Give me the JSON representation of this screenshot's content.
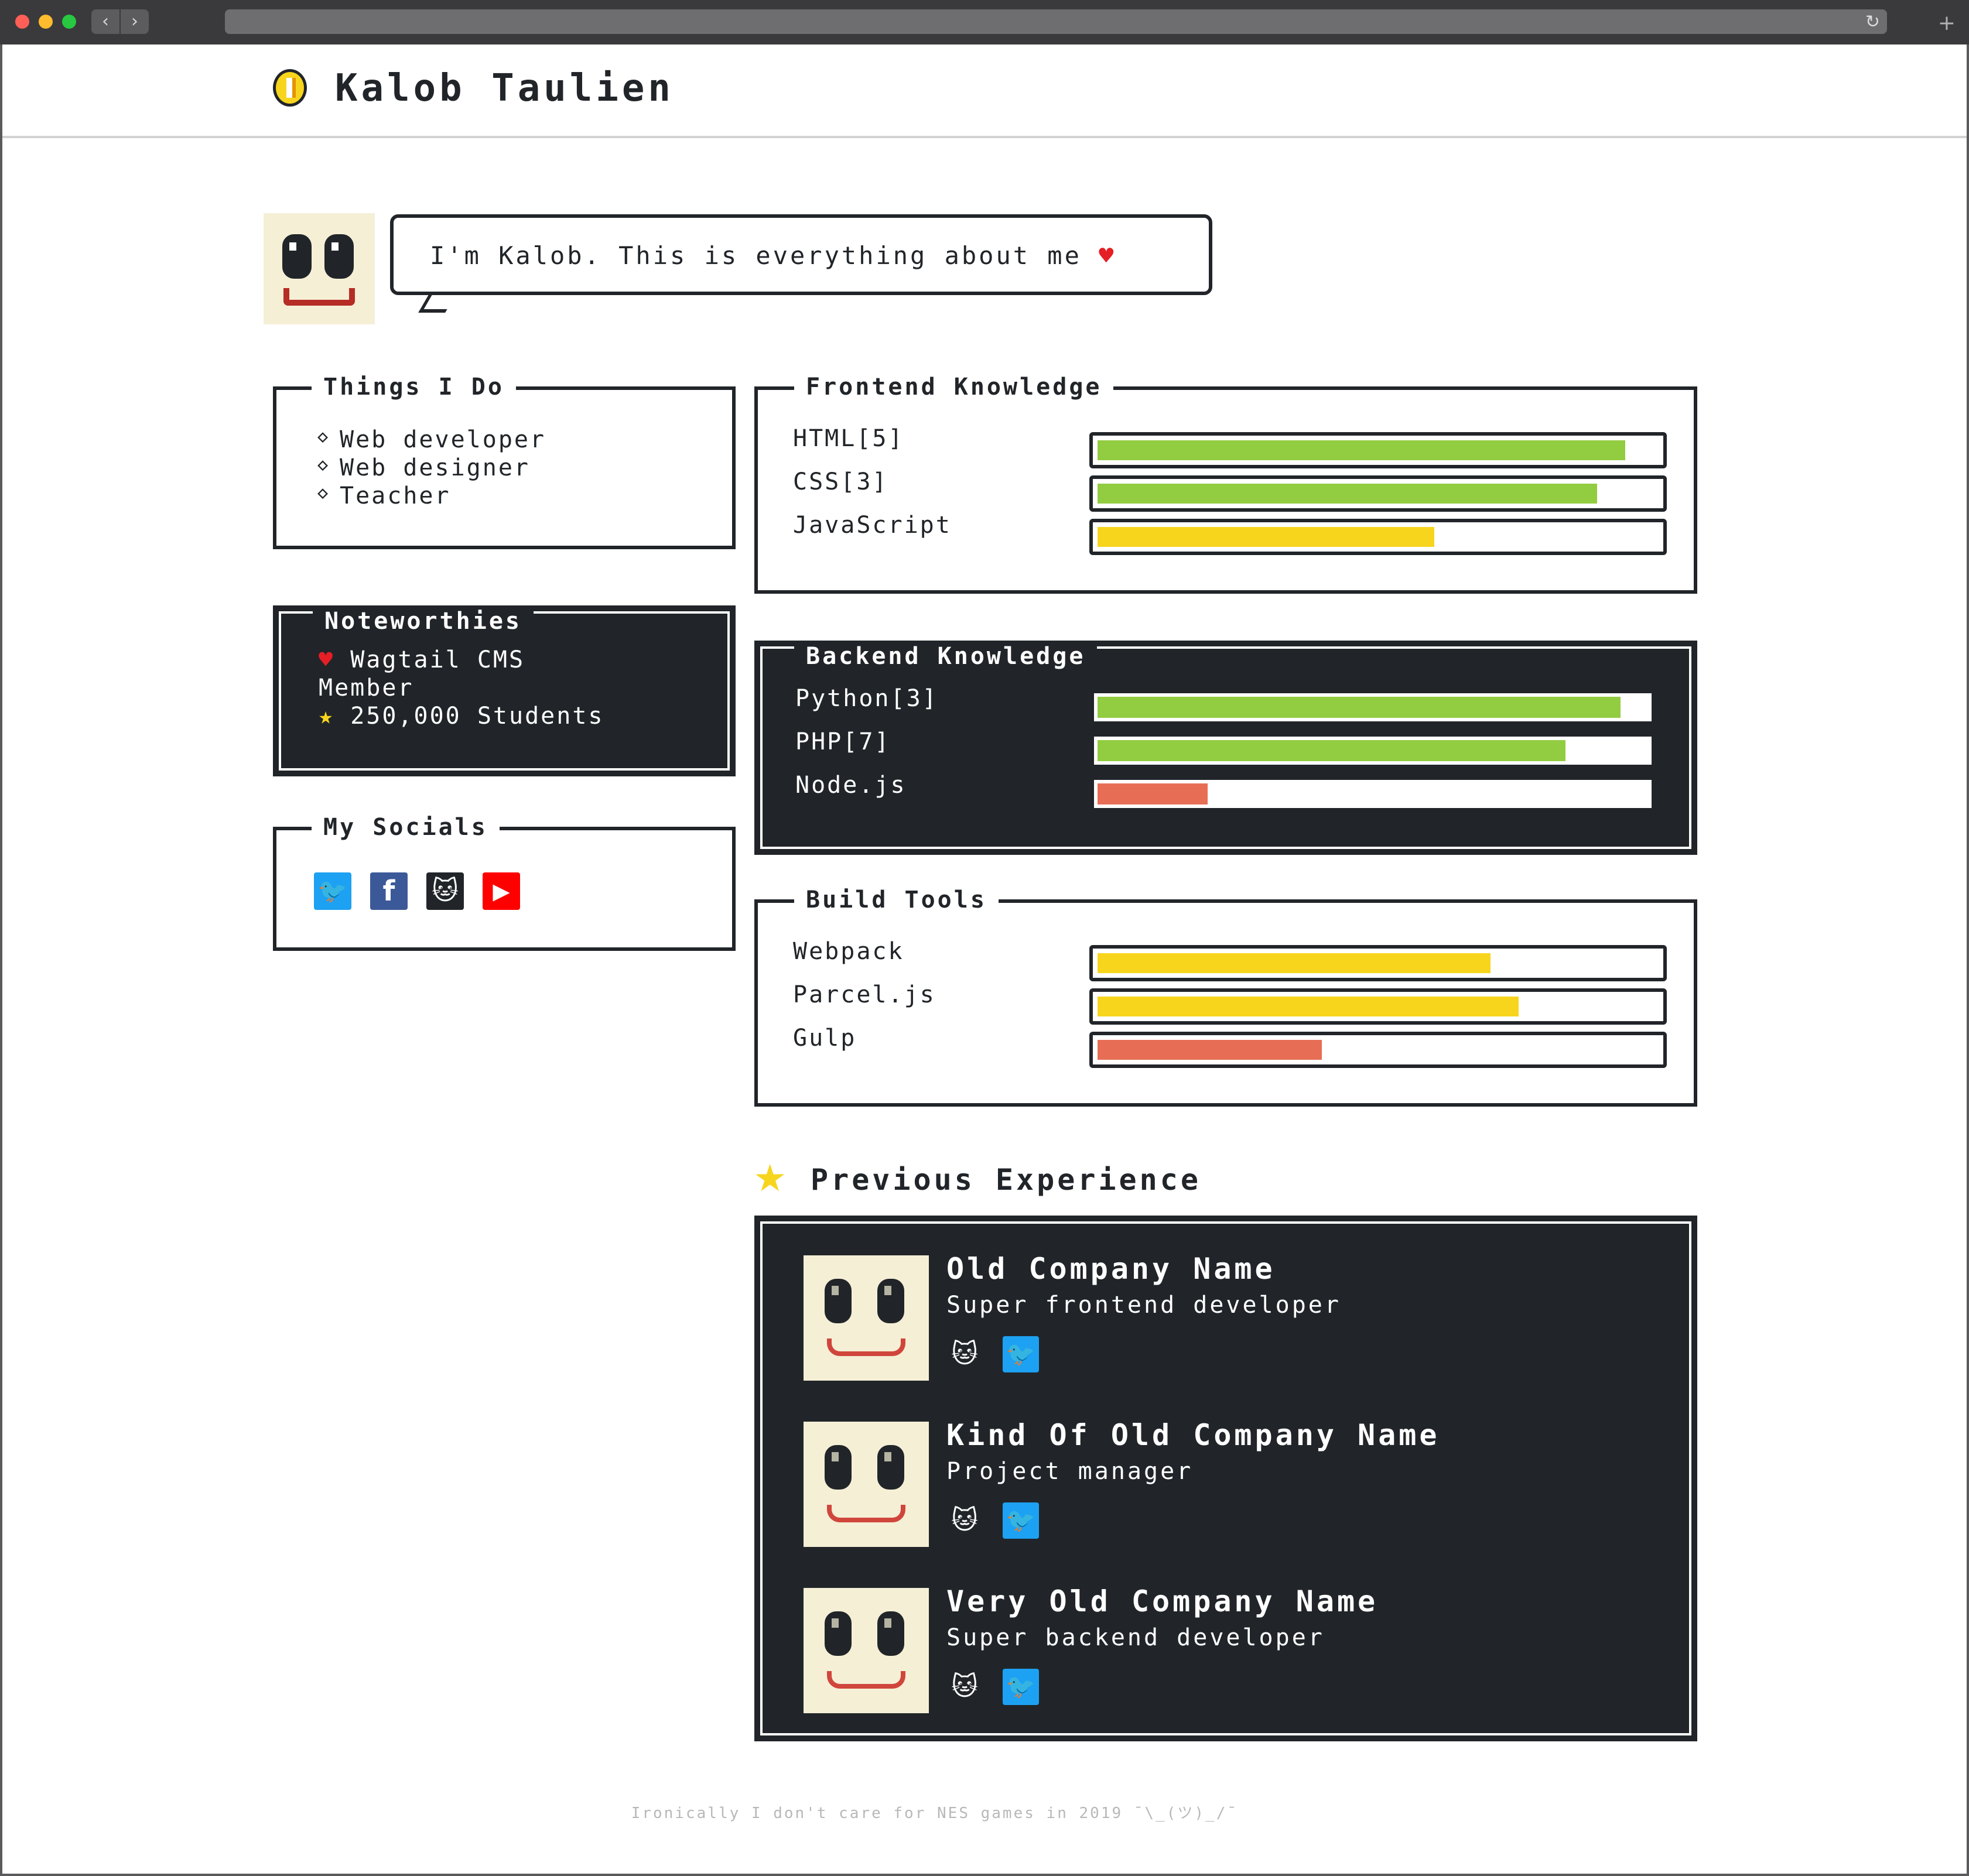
{
  "browser": {
    "back_icon": "‹",
    "forward_icon": "›",
    "reload_icon": "↻",
    "new_tab_icon": "+"
  },
  "header": {
    "title": "Kalob Taulien"
  },
  "intro": {
    "message": "I'm Kalob. This is everything about me",
    "heart": "♥"
  },
  "things_i_do": {
    "title": "Things I Do",
    "items": [
      "Web developer",
      "Web designer",
      "Teacher"
    ]
  },
  "noteworthies": {
    "title": "Noteworthies",
    "items": [
      {
        "icon": "♥",
        "text": "Wagtail CMS",
        "text2": "Member"
      },
      {
        "icon": "★",
        "text": "250,000 Students"
      }
    ]
  },
  "socials": {
    "title": "My Socials",
    "icons": [
      "twitter-icon",
      "facebook-icon",
      "github-icon",
      "youtube-icon"
    ]
  },
  "frontend": {
    "title": "Frontend Knowledge",
    "skills": [
      {
        "label": "HTML[5]",
        "level": 0.94,
        "color": "#92cc41"
      },
      {
        "label": "CSS[3]",
        "level": 0.89,
        "color": "#92cc41"
      },
      {
        "label": "JavaScript",
        "level": 0.6,
        "color": "#f7d51d"
      }
    ]
  },
  "backend": {
    "title": "Backend Knowledge",
    "skills": [
      {
        "label": "Python[3]",
        "level": 0.95,
        "color": "#92cc41"
      },
      {
        "label": "PHP[7]",
        "level": 0.85,
        "color": "#92cc41"
      },
      {
        "label": "Node.js",
        "level": 0.2,
        "color": "#e76e55"
      }
    ]
  },
  "build_tools": {
    "title": "Build Tools",
    "skills": [
      {
        "label": "Webpack",
        "level": 0.7,
        "color": "#f7d51d"
      },
      {
        "label": "Parcel.js",
        "level": 0.75,
        "color": "#f7d51d"
      },
      {
        "label": "Gulp",
        "level": 0.4,
        "color": "#e76e55"
      }
    ]
  },
  "experience": {
    "title": "Previous Experience",
    "star": "★",
    "items": [
      {
        "company": "Old Company Name",
        "role": "Super frontend developer"
      },
      {
        "company": "Kind Of Old Company Name",
        "role": "Project manager"
      },
      {
        "company": "Very Old Company Name",
        "role": "Super backend developer"
      }
    ]
  },
  "footer": {
    "text": "Ironically I don't care for NES games in 2019 ¯\\_(ツ)_/¯"
  }
}
